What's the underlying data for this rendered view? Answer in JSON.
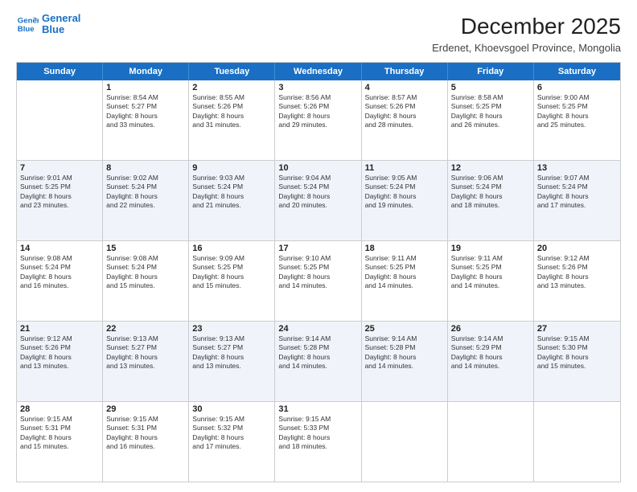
{
  "logo": {
    "line1": "General",
    "line2": "Blue"
  },
  "title": "December 2025",
  "subtitle": "Erdenet, Khoevsgoel Province, Mongolia",
  "header_days": [
    "Sunday",
    "Monday",
    "Tuesday",
    "Wednesday",
    "Thursday",
    "Friday",
    "Saturday"
  ],
  "weeks": [
    [
      {
        "day": "",
        "sunrise": "",
        "sunset": "",
        "daylight": ""
      },
      {
        "day": "1",
        "sunrise": "Sunrise: 8:54 AM",
        "sunset": "Sunset: 5:27 PM",
        "daylight": "Daylight: 8 hours and 33 minutes."
      },
      {
        "day": "2",
        "sunrise": "Sunrise: 8:55 AM",
        "sunset": "Sunset: 5:26 PM",
        "daylight": "Daylight: 8 hours and 31 minutes."
      },
      {
        "day": "3",
        "sunrise": "Sunrise: 8:56 AM",
        "sunset": "Sunset: 5:26 PM",
        "daylight": "Daylight: 8 hours and 29 minutes."
      },
      {
        "day": "4",
        "sunrise": "Sunrise: 8:57 AM",
        "sunset": "Sunset: 5:26 PM",
        "daylight": "Daylight: 8 hours and 28 minutes."
      },
      {
        "day": "5",
        "sunrise": "Sunrise: 8:58 AM",
        "sunset": "Sunset: 5:25 PM",
        "daylight": "Daylight: 8 hours and 26 minutes."
      },
      {
        "day": "6",
        "sunrise": "Sunrise: 9:00 AM",
        "sunset": "Sunset: 5:25 PM",
        "daylight": "Daylight: 8 hours and 25 minutes."
      }
    ],
    [
      {
        "day": "7",
        "sunrise": "Sunrise: 9:01 AM",
        "sunset": "Sunset: 5:25 PM",
        "daylight": "Daylight: 8 hours and 23 minutes."
      },
      {
        "day": "8",
        "sunrise": "Sunrise: 9:02 AM",
        "sunset": "Sunset: 5:24 PM",
        "daylight": "Daylight: 8 hours and 22 minutes."
      },
      {
        "day": "9",
        "sunrise": "Sunrise: 9:03 AM",
        "sunset": "Sunset: 5:24 PM",
        "daylight": "Daylight: 8 hours and 21 minutes."
      },
      {
        "day": "10",
        "sunrise": "Sunrise: 9:04 AM",
        "sunset": "Sunset: 5:24 PM",
        "daylight": "Daylight: 8 hours and 20 minutes."
      },
      {
        "day": "11",
        "sunrise": "Sunrise: 9:05 AM",
        "sunset": "Sunset: 5:24 PM",
        "daylight": "Daylight: 8 hours and 19 minutes."
      },
      {
        "day": "12",
        "sunrise": "Sunrise: 9:06 AM",
        "sunset": "Sunset: 5:24 PM",
        "daylight": "Daylight: 8 hours and 18 minutes."
      },
      {
        "day": "13",
        "sunrise": "Sunrise: 9:07 AM",
        "sunset": "Sunset: 5:24 PM",
        "daylight": "Daylight: 8 hours and 17 minutes."
      }
    ],
    [
      {
        "day": "14",
        "sunrise": "Sunrise: 9:08 AM",
        "sunset": "Sunset: 5:24 PM",
        "daylight": "Daylight: 8 hours and 16 minutes."
      },
      {
        "day": "15",
        "sunrise": "Sunrise: 9:08 AM",
        "sunset": "Sunset: 5:24 PM",
        "daylight": "Daylight: 8 hours and 15 minutes."
      },
      {
        "day": "16",
        "sunrise": "Sunrise: 9:09 AM",
        "sunset": "Sunset: 5:25 PM",
        "daylight": "Daylight: 8 hours and 15 minutes."
      },
      {
        "day": "17",
        "sunrise": "Sunrise: 9:10 AM",
        "sunset": "Sunset: 5:25 PM",
        "daylight": "Daylight: 8 hours and 14 minutes."
      },
      {
        "day": "18",
        "sunrise": "Sunrise: 9:11 AM",
        "sunset": "Sunset: 5:25 PM",
        "daylight": "Daylight: 8 hours and 14 minutes."
      },
      {
        "day": "19",
        "sunrise": "Sunrise: 9:11 AM",
        "sunset": "Sunset: 5:25 PM",
        "daylight": "Daylight: 8 hours and 14 minutes."
      },
      {
        "day": "20",
        "sunrise": "Sunrise: 9:12 AM",
        "sunset": "Sunset: 5:26 PM",
        "daylight": "Daylight: 8 hours and 13 minutes."
      }
    ],
    [
      {
        "day": "21",
        "sunrise": "Sunrise: 9:12 AM",
        "sunset": "Sunset: 5:26 PM",
        "daylight": "Daylight: 8 hours and 13 minutes."
      },
      {
        "day": "22",
        "sunrise": "Sunrise: 9:13 AM",
        "sunset": "Sunset: 5:27 PM",
        "daylight": "Daylight: 8 hours and 13 minutes."
      },
      {
        "day": "23",
        "sunrise": "Sunrise: 9:13 AM",
        "sunset": "Sunset: 5:27 PM",
        "daylight": "Daylight: 8 hours and 13 minutes."
      },
      {
        "day": "24",
        "sunrise": "Sunrise: 9:14 AM",
        "sunset": "Sunset: 5:28 PM",
        "daylight": "Daylight: 8 hours and 14 minutes."
      },
      {
        "day": "25",
        "sunrise": "Sunrise: 9:14 AM",
        "sunset": "Sunset: 5:28 PM",
        "daylight": "Daylight: 8 hours and 14 minutes."
      },
      {
        "day": "26",
        "sunrise": "Sunrise: 9:14 AM",
        "sunset": "Sunset: 5:29 PM",
        "daylight": "Daylight: 8 hours and 14 minutes."
      },
      {
        "day": "27",
        "sunrise": "Sunrise: 9:15 AM",
        "sunset": "Sunset: 5:30 PM",
        "daylight": "Daylight: 8 hours and 15 minutes."
      }
    ],
    [
      {
        "day": "28",
        "sunrise": "Sunrise: 9:15 AM",
        "sunset": "Sunset: 5:31 PM",
        "daylight": "Daylight: 8 hours and 15 minutes."
      },
      {
        "day": "29",
        "sunrise": "Sunrise: 9:15 AM",
        "sunset": "Sunset: 5:31 PM",
        "daylight": "Daylight: 8 hours and 16 minutes."
      },
      {
        "day": "30",
        "sunrise": "Sunrise: 9:15 AM",
        "sunset": "Sunset: 5:32 PM",
        "daylight": "Daylight: 8 hours and 17 minutes."
      },
      {
        "day": "31",
        "sunrise": "Sunrise: 9:15 AM",
        "sunset": "Sunset: 5:33 PM",
        "daylight": "Daylight: 8 hours and 18 minutes."
      },
      {
        "day": "",
        "sunrise": "",
        "sunset": "",
        "daylight": ""
      },
      {
        "day": "",
        "sunrise": "",
        "sunset": "",
        "daylight": ""
      },
      {
        "day": "",
        "sunrise": "",
        "sunset": "",
        "daylight": ""
      }
    ]
  ]
}
